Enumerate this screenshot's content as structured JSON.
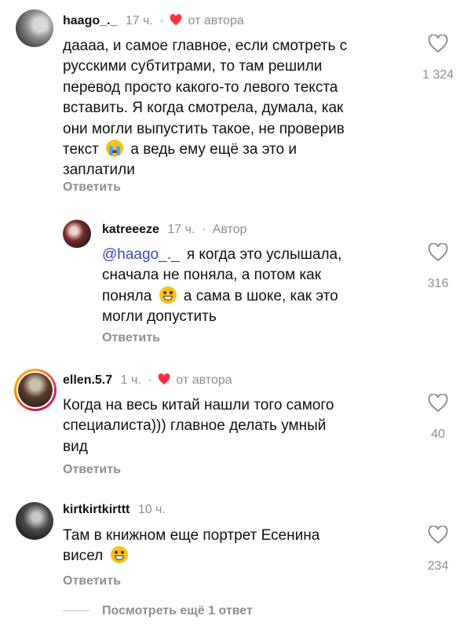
{
  "comments": [
    {
      "username": "haago_._",
      "time": "17 ч.",
      "sep": "·",
      "badge": "от автора",
      "text_lines": [
        "даааа, и самое главное, если смотреть с",
        "русскими субтитрами, то там решили",
        "перевод просто какого-то левого текста",
        "вставить. Я когда смотрела, думала, как",
        "они могли выпустить такое, не проверив"
      ],
      "text_line6a": "текст",
      "text_line6b": "а ведь ему ещё за это и",
      "text_line7": "заплатили",
      "reply_label": "Ответить",
      "likes": "1 324"
    },
    {
      "username": "katreeeze",
      "time": "17 ч.",
      "sep": "·",
      "badge": "Автор",
      "mention": "@haago_._",
      "text_line1": "я когда это услышала,",
      "text_line2": "сначала не поняла, а потом как",
      "text_line3a": "поняла",
      "text_line3b": "а сама в шоке, как это",
      "text_line4": "могли допустить",
      "reply_label": "Ответить",
      "likes": "316"
    },
    {
      "username": "ellen.5.7",
      "time": "1 ч.",
      "sep": "·",
      "badge": "от автора",
      "text_lines": [
        "Когда на весь китай нашли того самого",
        "специалиста))) главное делать умный",
        "вид"
      ],
      "reply_label": "Ответить",
      "likes": "40"
    },
    {
      "username": "kirtkirtkirttt",
      "time": "10 ч.",
      "text_line1": "Там в книжном еще портрет Есенина",
      "text_line2": "висел",
      "reply_label": "Ответить",
      "likes": "234"
    }
  ],
  "view_more": "Посмотреть ещё 1 ответ",
  "colors": {
    "heart": "#ff3040",
    "mention": "#3b4ab8",
    "muted": "#8e8e8e"
  }
}
